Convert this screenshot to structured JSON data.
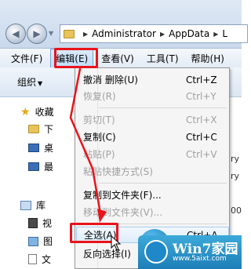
{
  "address_bar": {
    "crumbs": [
      "Administrator",
      "AppData",
      "L"
    ]
  },
  "menubar": {
    "items": [
      "文件(F)",
      "编辑(E)",
      "查看(V)",
      "工具(T)",
      "帮助(H)"
    ]
  },
  "toolbar": {
    "organize": "组织"
  },
  "navpane": {
    "favorites": "收藏",
    "fav_items": [
      "下",
      "桌",
      "最"
    ],
    "library": "库",
    "lib_items": [
      "视",
      "图",
      "文"
    ]
  },
  "right_fragments": [
    "ry",
    "ry",
    "00"
  ],
  "context_menu": {
    "items": [
      {
        "label": "撤消 删除(U)",
        "shortcut": "Ctrl+Z"
      },
      {
        "label": "恢复(R)",
        "shortcut": "Ctrl+Y"
      },
      {
        "label": "剪切(T)",
        "shortcut": "Ctrl+X"
      },
      {
        "label": "复制(C)",
        "shortcut": "Ctrl+C"
      },
      {
        "label": "粘贴(P)",
        "shortcut": "Ctrl+V"
      },
      {
        "label": "粘贴快捷方式(S)",
        "shortcut": ""
      },
      {
        "label": "复制到文件夹(F)...",
        "shortcut": ""
      },
      {
        "label": "移动到文件夹(V)...",
        "shortcut": ""
      },
      {
        "label": "全选(A)",
        "shortcut": "Ctrl+A"
      },
      {
        "label": "反向选择(I)",
        "shortcut": ""
      }
    ]
  },
  "watermark": {
    "brand": "Win7家园",
    "url": "www.5aixt.com"
  },
  "colors": {
    "highlight_red": "#e8141b",
    "menu_hover": "#c1dcf9",
    "disabled_text": "#a0a0a0"
  }
}
